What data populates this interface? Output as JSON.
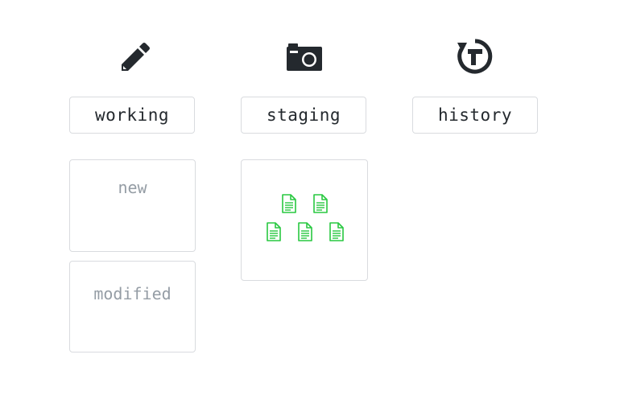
{
  "columns": [
    {
      "label": "working",
      "icon": "pencil-icon"
    },
    {
      "label": "staging",
      "icon": "camera-icon"
    },
    {
      "label": "history",
      "icon": "history-icon"
    }
  ],
  "working": {
    "panels": [
      {
        "label": "new"
      },
      {
        "label": "modified"
      }
    ]
  },
  "staging": {
    "file_count": 5
  },
  "colors": {
    "icon": "#24292e",
    "border": "#d9dbdf",
    "label_text": "#24292e",
    "muted_text": "#959da5",
    "file_green": "#28c840"
  }
}
